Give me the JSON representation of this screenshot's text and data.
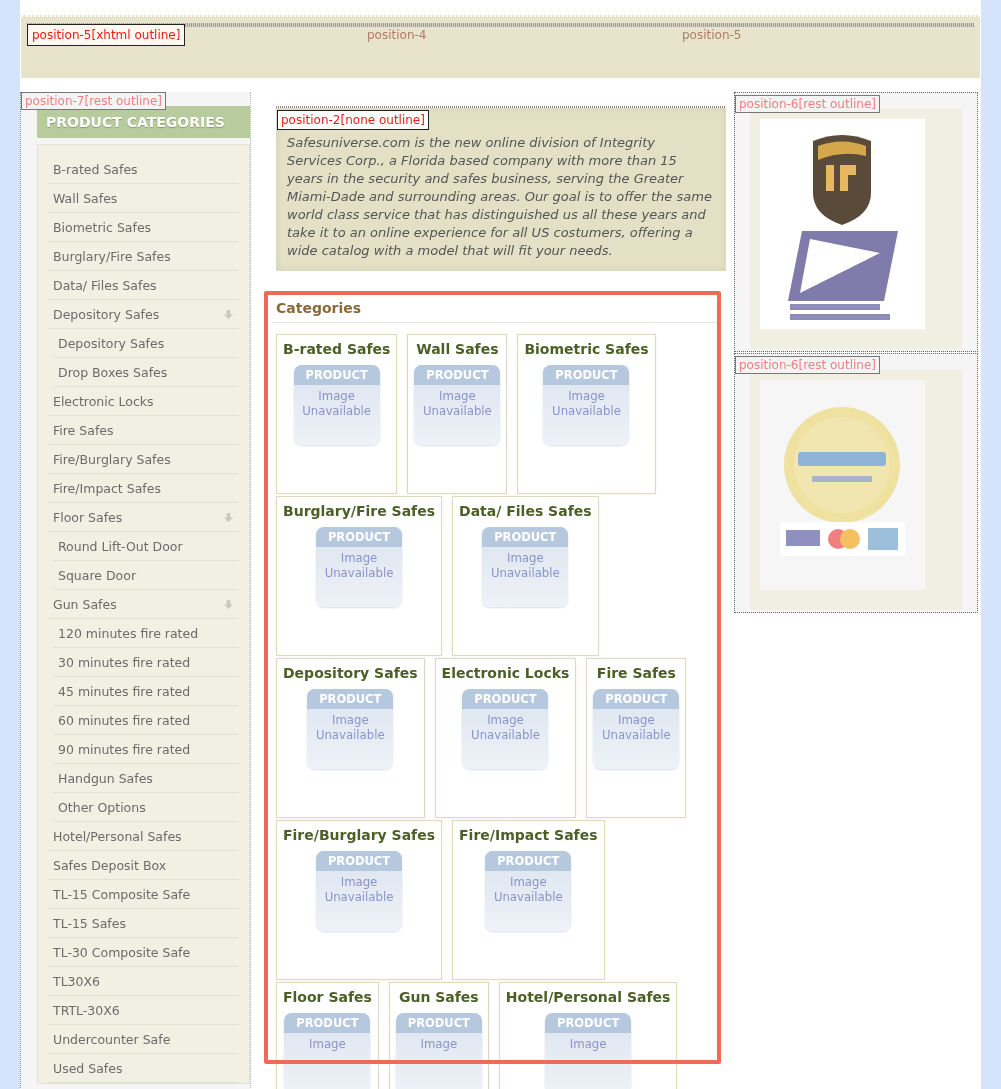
{
  "header": {
    "labels": [
      {
        "text": "position-5[xhtml outline]",
        "kind": "outlined"
      },
      {
        "text": "position-4",
        "kind": "plain"
      },
      {
        "text": "position-5",
        "kind": "plain"
      }
    ]
  },
  "sidebar": {
    "module_label": "position-7[rest outline]",
    "title": "PRODUCT CATEGORIES",
    "items": [
      {
        "label": "B-rated Safes"
      },
      {
        "label": "Wall Safes"
      },
      {
        "label": "Biometric Safes"
      },
      {
        "label": "Burglary/Fire Safes"
      },
      {
        "label": "Data/ Files Safes"
      },
      {
        "label": "Depository Safes",
        "children": [
          {
            "label": "Depository Safes"
          },
          {
            "label": "Drop Boxes Safes"
          }
        ]
      },
      {
        "label": "Electronic Locks"
      },
      {
        "label": "Fire Safes"
      },
      {
        "label": "Fire/Burglary Safes"
      },
      {
        "label": "Fire/Impact Safes"
      },
      {
        "label": "Floor Safes",
        "children": [
          {
            "label": "Round Lift-Out Door"
          },
          {
            "label": "Square Door"
          }
        ]
      },
      {
        "label": "Gun Safes",
        "children": [
          {
            "label": "120 minutes fire rated"
          },
          {
            "label": "30 minutes fire rated"
          },
          {
            "label": "45 minutes fire rated"
          },
          {
            "label": "60 minutes fire rated"
          },
          {
            "label": "90 minutes fire rated"
          },
          {
            "label": "Handgun Safes"
          },
          {
            "label": "Other Options"
          }
        ]
      },
      {
        "label": "Hotel/Personal Safes"
      },
      {
        "label": "Safes Deposit Box"
      },
      {
        "label": "TL-15 Composite Safe"
      },
      {
        "label": "TL-15 Safes"
      },
      {
        "label": "TL-30 Composite Safe"
      },
      {
        "label": "TL30X6"
      },
      {
        "label": "TRTL-30X6"
      },
      {
        "label": "Undercounter Safe"
      },
      {
        "label": "Used Safes"
      }
    ]
  },
  "intro": {
    "module_label": "position-2[none outline]",
    "text": "Safesuniverse.com is the new online division of Integrity Services Corp., a Florida based company with more than 15 years in the security and safes business, serving the Greater Miami-Dade and surrounding areas. Our goal is to offer the same world class service that has distinguished us all these years and take it to an online experience for all US costumers, offering  a wide catalog with a model that will fit your needs."
  },
  "categories": {
    "title": "Categories",
    "highlighted": true,
    "rows": [
      [
        {
          "name": "B-rated Safes",
          "placeholder": [
            "PRODUCT",
            "Image",
            "Unavailable"
          ]
        },
        {
          "name": "Wall Safes",
          "placeholder": [
            "PRODUCT",
            "Image",
            "Unavailable"
          ]
        },
        {
          "name": "Biometric Safes",
          "placeholder": [
            "PRODUCT",
            "Image",
            "Unavailable"
          ]
        }
      ],
      [
        {
          "name": "Burglary/Fire Safes",
          "placeholder": [
            "PRODUCT",
            "Image",
            "Unavailable"
          ]
        },
        {
          "name": "Data/ Files Safes",
          "placeholder": [
            "PRODUCT",
            "Image",
            "Unavailable"
          ]
        }
      ],
      [
        {
          "name": "Depository Safes",
          "placeholder": [
            "PRODUCT",
            "Image",
            "Unavailable"
          ]
        },
        {
          "name": "Electronic Locks",
          "placeholder": [
            "PRODUCT",
            "Image",
            "Unavailable"
          ]
        },
        {
          "name": "Fire Safes",
          "placeholder": [
            "PRODUCT",
            "Image",
            "Unavailable"
          ]
        }
      ],
      [
        {
          "name": "Fire/Burglary Safes",
          "placeholder": [
            "PRODUCT",
            "Image",
            "Unavailable"
          ]
        },
        {
          "name": "Fire/Impact Safes",
          "placeholder": [
            "PRODUCT",
            "Image",
            "Unavailable"
          ]
        }
      ],
      [
        {
          "name": "Floor Safes",
          "placeholder": [
            "PRODUCT",
            "Image"
          ]
        },
        {
          "name": "Gun Safes",
          "placeholder": [
            "PRODUCT",
            "Image"
          ]
        },
        {
          "name": "Hotel/Personal Safes",
          "placeholder": [
            "PRODUCT",
            "Image"
          ]
        }
      ]
    ]
  },
  "right_modules": [
    {
      "module_label": "position-6[rest outline]",
      "kind": "shipping"
    },
    {
      "module_label": "position-6[rest outline]",
      "kind": "payment"
    }
  ]
}
